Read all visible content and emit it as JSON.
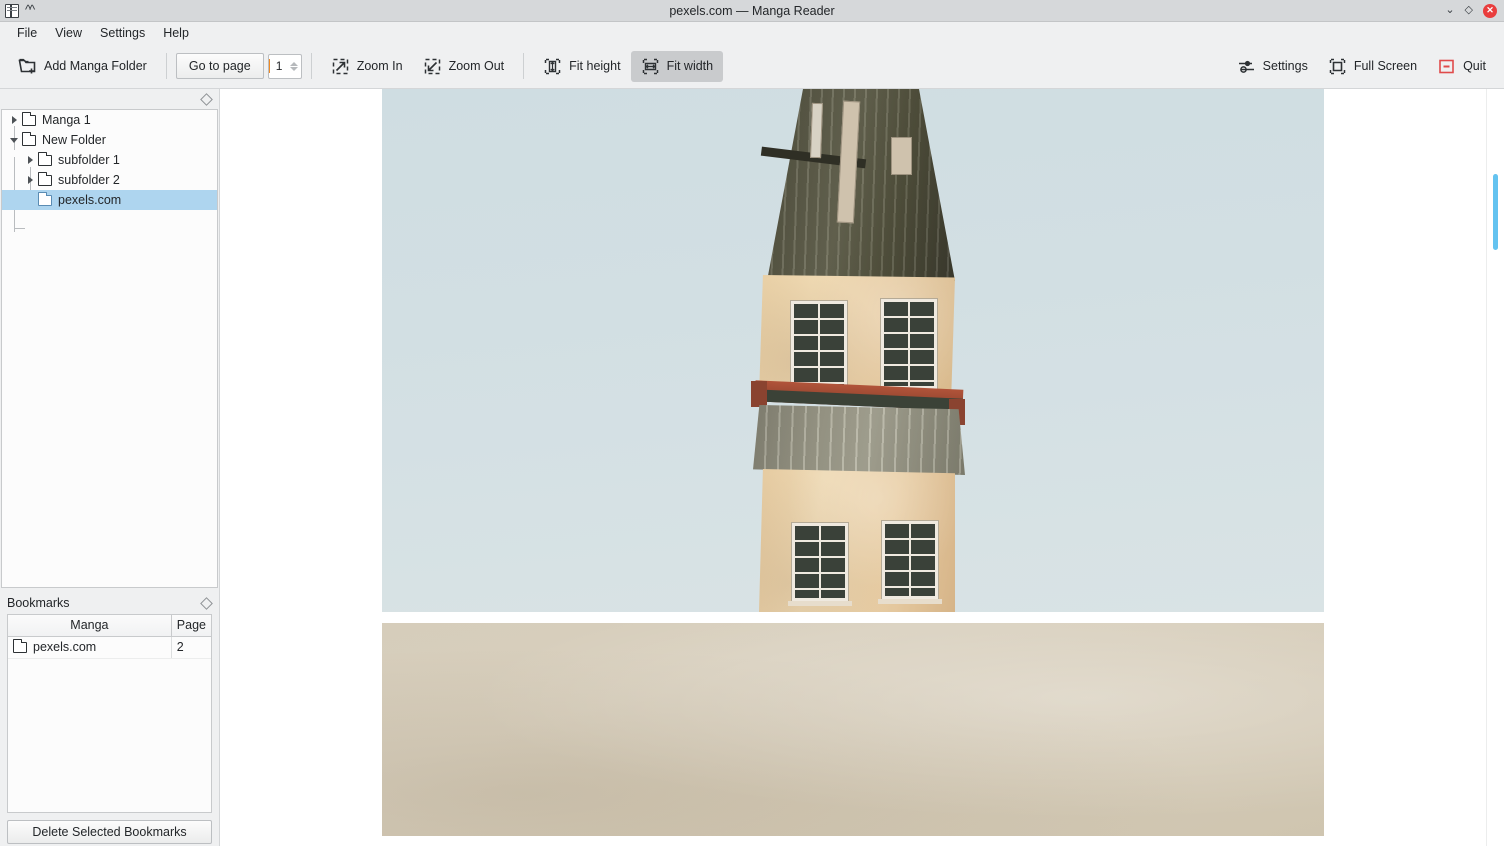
{
  "window": {
    "title": "pexels.com — Manga Reader",
    "app_icon": "book-icon",
    "collapse_icon": "double-chevron-up-icon",
    "minimize_label": "⌄",
    "maximize_label": "◇",
    "close_label": "✕",
    "accent_color": "#3daee9",
    "close_color": "#e93d3d",
    "titlebar_color": "#d6d8da"
  },
  "menubar": {
    "items": [
      {
        "label": "File"
      },
      {
        "label": "View"
      },
      {
        "label": "Settings"
      },
      {
        "label": "Help"
      }
    ]
  },
  "toolbar": {
    "add_folder": {
      "label": "Add Manga Folder",
      "icon": "folder-add-icon"
    },
    "go_to_page": {
      "label": "Go to page"
    },
    "page_spinner": {
      "value": "1",
      "up_icon": "caret-up-icon",
      "down_icon": "caret-down-icon"
    },
    "zoom_in": {
      "label": "Zoom In",
      "icon": "zoom-in-icon"
    },
    "zoom_out": {
      "label": "Zoom Out",
      "icon": "zoom-out-icon"
    },
    "fit_height": {
      "label": "Fit height",
      "icon": "fit-height-icon",
      "checked": false
    },
    "fit_width": {
      "label": "Fit width",
      "icon": "fit-width-icon",
      "checked": true
    },
    "settings": {
      "label": "Settings",
      "icon": "sliders-icon"
    },
    "full_screen": {
      "label": "Full Screen",
      "icon": "fullscreen-icon"
    },
    "quit": {
      "label": "Quit",
      "icon": "quit-icon"
    }
  },
  "sidebar": {
    "tree_panel": {
      "float_icon": "float-panel-icon",
      "items": [
        {
          "label": "Manga 1",
          "depth": 0,
          "expanded": false,
          "has_children": true,
          "selected": false,
          "icon": "folder-icon"
        },
        {
          "label": "New Folder",
          "depth": 0,
          "expanded": true,
          "has_children": true,
          "selected": false,
          "icon": "folder-icon"
        },
        {
          "label": "subfolder 1",
          "depth": 1,
          "expanded": false,
          "has_children": true,
          "selected": false,
          "icon": "folder-icon"
        },
        {
          "label": "subfolder 2",
          "depth": 1,
          "expanded": false,
          "has_children": true,
          "selected": false,
          "icon": "folder-icon"
        },
        {
          "label": "pexels.com",
          "depth": 1,
          "expanded": false,
          "has_children": false,
          "selected": true,
          "icon": "folder-icon"
        }
      ],
      "selection_color": "#aed5ef"
    },
    "bookmarks": {
      "title": "Bookmarks",
      "float_icon": "float-panel-icon",
      "columns": [
        "Manga",
        "Page"
      ],
      "rows": [
        {
          "manga": "pexels.com",
          "page": "2",
          "icon": "folder-icon"
        }
      ],
      "delete_button": "Delete Selected Bookmarks"
    }
  },
  "viewer": {
    "background_color": "#ffffff",
    "scrollbar": {
      "thumb_color": "#64c3f0"
    },
    "pages": [
      {
        "index": 1,
        "alt": "Tall narrow pastel building with weathered metal roofs against a pale blue sky",
        "dominant_colors": [
          "#d2dfe3",
          "#e8cfa5",
          "#55543f",
          "#a6a492"
        ]
      },
      {
        "index": 2,
        "alt": "Soft beige gradient wall",
        "dominant_colors": [
          "#d6cdbb",
          "#cfc5b0"
        ]
      }
    ]
  }
}
